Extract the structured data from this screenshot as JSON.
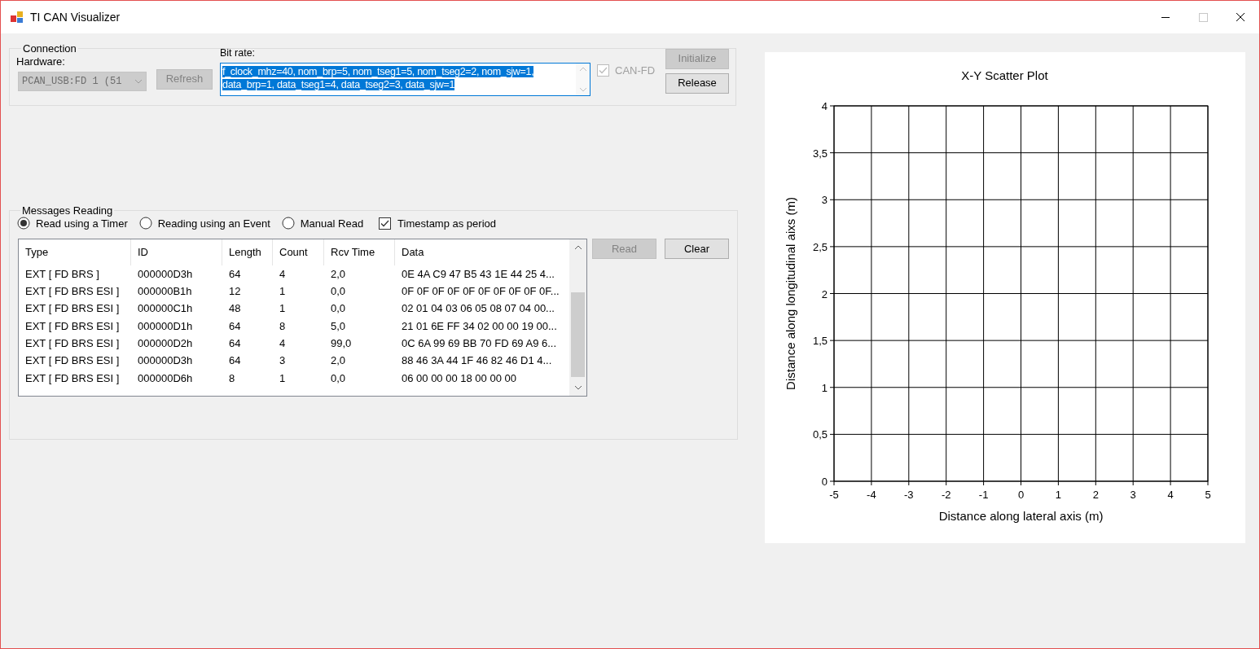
{
  "window": {
    "title": "TI CAN Visualizer",
    "maximize_disabled": true
  },
  "connection": {
    "legend": "Connection",
    "hardware_label": "Hardware:",
    "hardware": {
      "value": "PCAN_USB:FD 1 (51",
      "disabled": true
    },
    "refresh": {
      "label": "Refresh",
      "disabled": true
    },
    "bit_rate": {
      "label": "Bit rate:",
      "lines": [
        "f_clock_mhz=40, nom_brp=5, nom_tseg1=5, nom_tseg2=2, nom_sjw=1,",
        "data_brp=1, data_tseg1=4, data_tseg2=3, data_sjw=1"
      ],
      "selected": true
    },
    "can_fd": {
      "label": "CAN-FD",
      "checked": true,
      "disabled": true
    },
    "buttons": [
      {
        "label": "Initialize",
        "disabled": true
      },
      {
        "label": "Release",
        "disabled": false
      }
    ]
  },
  "messages": {
    "legend": "Messages Reading",
    "modes": [
      {
        "label": "Read using a Timer",
        "kind": "radio",
        "selected": true
      },
      {
        "label": "Reading using an Event",
        "kind": "radio",
        "selected": false
      },
      {
        "label": "Manual Read",
        "kind": "radio",
        "selected": false
      },
      {
        "label": "Timestamp as period",
        "kind": "checkbox",
        "checked": true
      }
    ],
    "table": {
      "columns": [
        "Type",
        "ID",
        "Length",
        "Count",
        "Rcv Time",
        "Data"
      ],
      "rows": [
        [
          "EXT [  FD BRS ]",
          "000000D3h",
          "64",
          "4",
          "2,0",
          "0E 4A C9 47 B5 43 1E 44 25 4..."
        ],
        [
          "EXT [  FD BRS ESI ]",
          "000000B1h",
          "12",
          "1",
          "0,0",
          "0F 0F 0F 0F 0F 0F 0F 0F 0F 0F..."
        ],
        [
          "EXT [  FD BRS ESI ]",
          "000000C1h",
          "48",
          "1",
          "0,0",
          "02 01 04 03 06 05 08 07 04 00..."
        ],
        [
          "EXT [  FD BRS ESI ]",
          "000000D1h",
          "64",
          "8",
          "5,0",
          "21 01 6E FF 34 02 00 00 19 00..."
        ],
        [
          "EXT [  FD BRS ESI ]",
          "000000D2h",
          "64",
          "4",
          "99,0",
          "0C 6A 99 69 BB 70 FD 69 A9 6..."
        ],
        [
          "EXT [  FD BRS ESI ]",
          "000000D3h",
          "64",
          "3",
          "2,0",
          "88 46 3A 44 1F 46 82 46 D1 4..."
        ],
        [
          "EXT [  FD BRS ESI ]",
          "000000D6h",
          "8",
          "1",
          "0,0",
          "06 00 00 00 18 00 00 00"
        ]
      ]
    },
    "buttons": [
      {
        "label": "Read",
        "disabled": true
      },
      {
        "label": "Clear",
        "disabled": false
      }
    ]
  },
  "chart": {
    "chart_data": {
      "type": "scatter",
      "grid": true,
      "title": "X-Y Scatter Plot",
      "xlabel": "Distance along lateral axis (m)",
      "ylabel": "Distance along longitudinal aixs (m)",
      "xlim": [
        -5,
        5
      ],
      "ylim": [
        0,
        4
      ],
      "xticks": [
        -5,
        -4,
        -3,
        -2,
        -1,
        0,
        1,
        2,
        3,
        4,
        5
      ],
      "yticks": [
        0,
        {
          "value": 0.5,
          "label": "0,5"
        },
        1,
        {
          "value": 1.5,
          "label": "1,5"
        },
        2,
        {
          "value": 2.5,
          "label": "2,5"
        },
        3,
        {
          "value": 3.5,
          "label": "3,5"
        },
        4
      ]
    }
  }
}
